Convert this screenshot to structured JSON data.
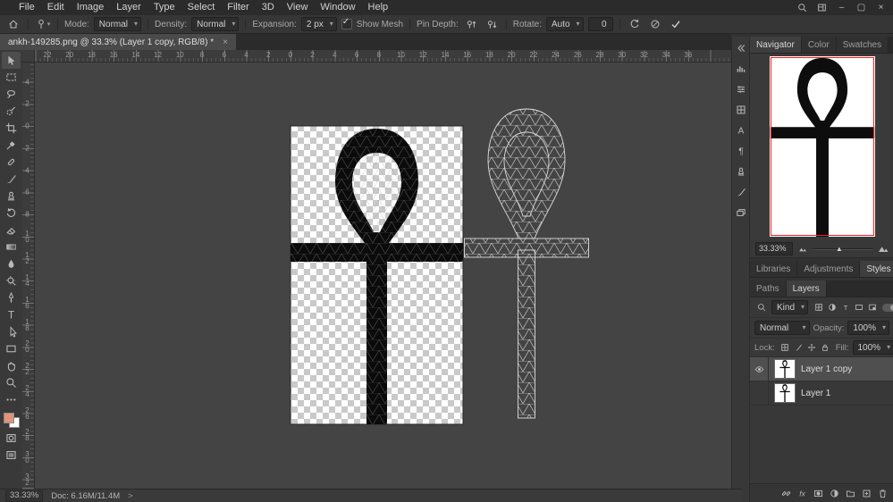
{
  "colors": {
    "foreground": "#e2937b",
    "background": "#ffffff",
    "navigator_proxy": "#ff1f1f",
    "mesh_line": "#d8d8d8",
    "ankh_fill": "#0b0b0b"
  },
  "menubar": {
    "items": [
      "File",
      "Edit",
      "Image",
      "Layer",
      "Type",
      "Select",
      "Filter",
      "3D",
      "View",
      "Window",
      "Help"
    ],
    "controls": {
      "minimize": "–",
      "maximize": "▢",
      "close": "×"
    }
  },
  "optionsbar": {
    "mode_label": "Mode:",
    "mode_value": "Normal",
    "density_label": "Density:",
    "density_value": "Normal",
    "expansion_label": "Expansion:",
    "expansion_value": "2 px",
    "show_mesh_label": "Show Mesh",
    "show_mesh_checked": true,
    "pin_depth_label": "Pin Depth:",
    "rotate_label": "Rotate:",
    "rotate_mode": "Auto",
    "rotate_value": "0"
  },
  "tabbar": {
    "title": "ankh-149285.png @ 33.3% (Layer 1 copy, RGB/8) *",
    "close_glyph": "×"
  },
  "toolbar": {
    "tools": [
      {
        "name": "move",
        "icon": "move"
      },
      {
        "name": "rectangular-marquee",
        "icon": "marquee"
      },
      {
        "name": "lasso",
        "icon": "lasso"
      },
      {
        "name": "quick-selection",
        "icon": "quickselect"
      },
      {
        "name": "crop",
        "icon": "crop"
      },
      {
        "name": "eyedropper",
        "icon": "eyedropper"
      },
      {
        "name": "spot-healing-brush",
        "icon": "healing"
      },
      {
        "name": "brush",
        "icon": "brush"
      },
      {
        "name": "clone-stamp",
        "icon": "stamp"
      },
      {
        "name": "history-brush",
        "icon": "history"
      },
      {
        "name": "eraser",
        "icon": "eraser"
      },
      {
        "name": "gradient",
        "icon": "gradient"
      },
      {
        "name": "blur",
        "icon": "blur"
      },
      {
        "name": "dodge",
        "icon": "dodge"
      },
      {
        "name": "pen",
        "icon": "pen"
      },
      {
        "name": "horizontal-type",
        "icon": "type"
      },
      {
        "name": "path-selection",
        "icon": "pathselect"
      },
      {
        "name": "rectangle",
        "icon": "shape"
      },
      {
        "name": "hand",
        "icon": "hand"
      },
      {
        "name": "zoom",
        "icon": "zoom"
      }
    ]
  },
  "rulers": {
    "top": [
      "22",
      "20",
      "18",
      "16",
      "14",
      "12",
      "10",
      "8",
      "6",
      "4",
      "2",
      "0",
      "2",
      "4",
      "6",
      "8",
      "10",
      "12",
      "14",
      "16",
      "18",
      "20",
      "22",
      "24",
      "26",
      "28",
      "30",
      "32",
      "34",
      "36"
    ],
    "left": [
      "6",
      "4",
      "2",
      "0",
      "2",
      "4",
      "6",
      "8",
      "10",
      "12",
      "14",
      "16",
      "18",
      "20",
      "22",
      "24",
      "26",
      "28",
      "30",
      "32"
    ]
  },
  "right_strip": {
    "icons": [
      {
        "name": "collapse-panels",
        "icon": "chevl"
      },
      {
        "name": "histogram",
        "icon": "bars"
      },
      {
        "name": "color",
        "icon": "sliders"
      },
      {
        "name": "swatches",
        "icon": "grid"
      },
      {
        "name": "character",
        "icon": "charA"
      },
      {
        "name": "paragraph",
        "icon": "para"
      },
      {
        "name": "clone-source",
        "icon": "stamp"
      },
      {
        "name": "brush-settings",
        "icon": "brush"
      },
      {
        "name": "layer-comps",
        "icon": "layers2"
      }
    ]
  },
  "navigator": {
    "tabs": [
      "Navigator",
      "Color",
      "Swatches"
    ],
    "zoom": "33.33%"
  },
  "panel_tabs_a": [
    "Libraries",
    "Adjustments",
    "Styles"
  ],
  "panel_tabs_b": [
    "Paths",
    "Layers"
  ],
  "layers_panel": {
    "kind_label": "Kind",
    "filters": [
      {
        "name": "pixel-layers",
        "icon": "grid"
      },
      {
        "name": "adjustment-layers",
        "icon": "adjust"
      },
      {
        "name": "type-layers",
        "icon": "typeT"
      },
      {
        "name": "shape-layers",
        "icon": "shape"
      },
      {
        "name": "smart-objects",
        "icon": "smart"
      }
    ],
    "blend_mode": "Normal",
    "opacity_label": "Opacity:",
    "opacity_value": "100%",
    "lock_label": "Lock:",
    "locks": [
      {
        "name": "lock-transparent-pixels",
        "icon": "grid"
      },
      {
        "name": "lock-image-pixels",
        "icon": "brush"
      },
      {
        "name": "lock-position",
        "icon": "cross"
      },
      {
        "name": "lock-all",
        "icon": "lock"
      }
    ],
    "fill_label": "Fill:",
    "fill_value": "100%",
    "layers": [
      {
        "name": "Layer 1 copy",
        "visible": true,
        "selected": true
      },
      {
        "name": "Layer 1",
        "visible": false,
        "selected": false
      }
    ],
    "actions": [
      {
        "name": "link-layers",
        "icon": "chain"
      },
      {
        "name": "layer-style",
        "icon": "fx"
      },
      {
        "name": "add-layer-mask",
        "icon": "mask"
      },
      {
        "name": "new-adjustment-layer",
        "icon": "adjust"
      },
      {
        "name": "new-group",
        "icon": "folder"
      },
      {
        "name": "new-layer",
        "icon": "newlayer"
      },
      {
        "name": "delete-layer",
        "icon": "trash"
      }
    ]
  },
  "statusbar": {
    "zoom": "33.33%",
    "doc_info": "Doc: 6.16M/11.4M",
    "expand_glyph": ">"
  }
}
